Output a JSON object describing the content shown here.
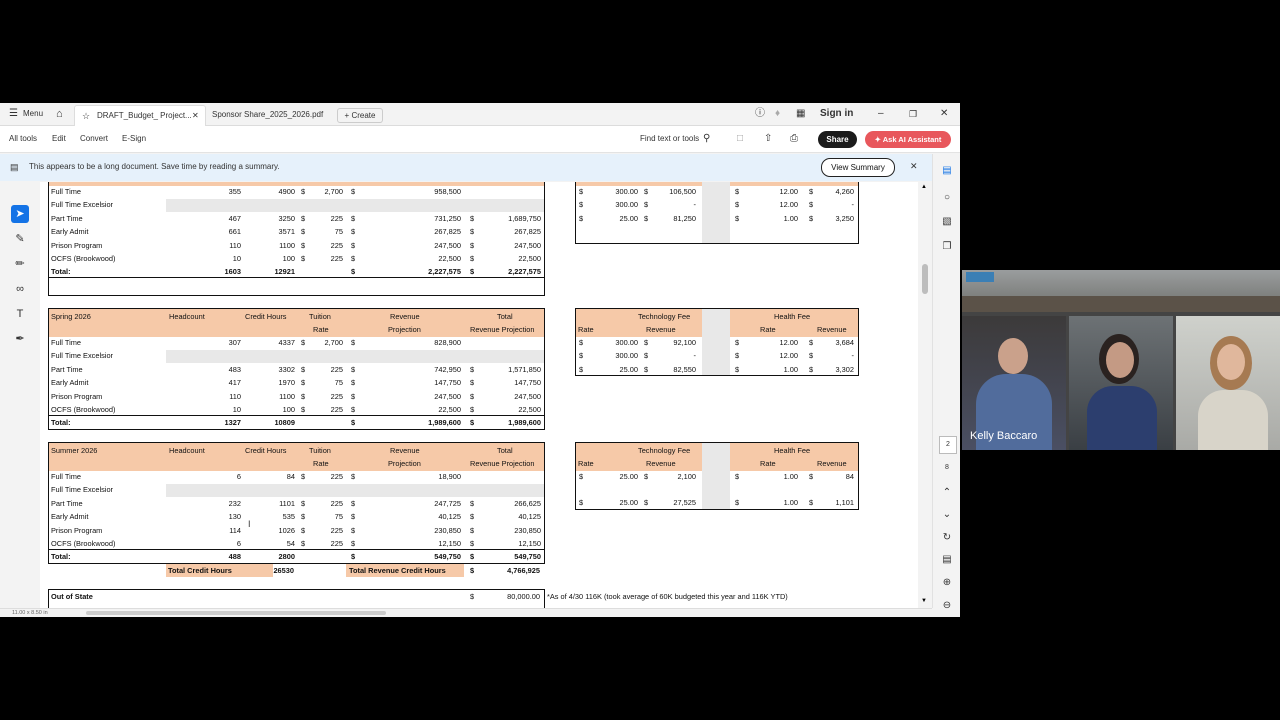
{
  "window": {
    "menu_label": "Menu",
    "tabs": [
      {
        "label": "DRAFT_Budget_ Project..."
      },
      {
        "label": "Sponsor Share_2025_2026.pdf"
      }
    ],
    "create_label": "Create",
    "sign_in": "Sign in"
  },
  "toolbar": {
    "items": [
      "All tools",
      "Edit",
      "Convert",
      "E-Sign"
    ],
    "find_label": "Find text or tools",
    "share_label": "Share",
    "ai_label": "Ask AI Assistant"
  },
  "banner": {
    "message": "This appears to be a long document. Save time by reading a summary.",
    "button": "View Summary"
  },
  "page_size": "11.00 x 8.50 in",
  "page_numbers": [
    "2",
    "8"
  ],
  "fall_table": {
    "rows": [
      {
        "label": "Full Time",
        "headcount": "355",
        "hours": "4900",
        "rate": "2,700",
        "projection": "958,500",
        "total": ""
      },
      {
        "label": "Full Time Excelsior",
        "headcount": "",
        "hours": "",
        "rate": "",
        "projection": "",
        "total": ""
      },
      {
        "label": "Part Time",
        "headcount": "467",
        "hours": "3250",
        "rate": "225",
        "projection": "731,250",
        "total": "1,689,750"
      },
      {
        "label": "Early Admit",
        "headcount": "661",
        "hours": "3571",
        "rate": "75",
        "projection": "267,825",
        "total": "267,825"
      },
      {
        "label": "Prison Program",
        "headcount": "110",
        "hours": "1100",
        "rate": "225",
        "projection": "247,500",
        "total": "247,500"
      },
      {
        "label": "OCFS (Brookwood)",
        "headcount": "10",
        "hours": "100",
        "rate": "225",
        "projection": "22,500",
        "total": "22,500"
      },
      {
        "label": "Total:",
        "headcount": "1603",
        "hours": "12921",
        "rate": "",
        "projection": "2,227,575",
        "total": "2,227,575"
      }
    ]
  },
  "fall_fees": {
    "rows": [
      {
        "tech_rate": "300.00",
        "tech_rev": "106,500",
        "health_rate": "12.00",
        "health_rev": "4,260"
      },
      {
        "tech_rate": "300.00",
        "tech_rev": "-",
        "health_rate": "12.00",
        "health_rev": "-"
      },
      {
        "tech_rate": "25.00",
        "tech_rev": "81,250",
        "health_rate": "1.00",
        "health_rev": "3,250"
      }
    ]
  },
  "spring_table": {
    "term": "Spring 2026",
    "headers": {
      "headcount": "Headcount",
      "hours": "Credit Hours",
      "tuition": "Tuition",
      "rate": "Rate",
      "revenue": "Revenue",
      "projection": "Projection",
      "total": "Total",
      "total_projection": "Revenue Projection"
    },
    "rows": [
      {
        "label": "Full Time",
        "headcount": "307",
        "hours": "4337",
        "rate": "2,700",
        "projection": "828,900",
        "total": ""
      },
      {
        "label": "Full Time Excelsior",
        "headcount": "",
        "hours": "",
        "rate": "",
        "projection": "",
        "total": ""
      },
      {
        "label": "Part Time",
        "headcount": "483",
        "hours": "3302",
        "rate": "225",
        "projection": "742,950",
        "total": "1,571,850"
      },
      {
        "label": "Early Admit",
        "headcount": "417",
        "hours": "1970",
        "rate": "75",
        "projection": "147,750",
        "total": "147,750"
      },
      {
        "label": "Prison Program",
        "headcount": "110",
        "hours": "1100",
        "rate": "225",
        "projection": "247,500",
        "total": "247,500"
      },
      {
        "label": "OCFS (Brookwood)",
        "headcount": "10",
        "hours": "100",
        "rate": "225",
        "projection": "22,500",
        "total": "22,500"
      },
      {
        "label": "Total:",
        "headcount": "1327",
        "hours": "10809",
        "rate": "",
        "projection": "1,989,600",
        "total": "1,989,600"
      }
    ]
  },
  "spring_fees": {
    "tech_title": "Technology Fee",
    "health_title": "Health Fee",
    "rate_label": "Rate",
    "revenue_label": "Revenue",
    "rows": [
      {
        "tech_rate": "300.00",
        "tech_rev": "92,100",
        "health_rate": "12.00",
        "health_rev": "3,684"
      },
      {
        "tech_rate": "300.00",
        "tech_rev": "-",
        "health_rate": "12.00",
        "health_rev": "-"
      },
      {
        "tech_rate": "25.00",
        "tech_rev": "82,550",
        "health_rate": "1.00",
        "health_rev": "3,302"
      }
    ]
  },
  "summer_table": {
    "term": "Summer 2026",
    "headers": {
      "headcount": "Headcount",
      "hours": "Credit Hours",
      "tuition": "Tuition",
      "rate": "Rate",
      "revenue": "Revenue",
      "projection": "Projection",
      "total": "Total",
      "total_projection": "Revenue Projection"
    },
    "rows": [
      {
        "label": "Full Time",
        "headcount": "6",
        "hours": "84",
        "rate": "225",
        "projection": "18,900",
        "total": ""
      },
      {
        "label": "Full Time Excelsior",
        "headcount": "",
        "hours": "",
        "rate": "",
        "projection": "",
        "total": ""
      },
      {
        "label": "Part Time",
        "headcount": "232",
        "hours": "1101",
        "rate": "225",
        "projection": "247,725",
        "total": "266,625"
      },
      {
        "label": "Early Admit",
        "headcount": "130",
        "hours": "535",
        "rate": "75",
        "projection": "40,125",
        "total": "40,125"
      },
      {
        "label": "Prison Program",
        "headcount": "114",
        "hours": "1026",
        "rate": "225",
        "projection": "230,850",
        "total": "230,850"
      },
      {
        "label": "OCFS (Brookwood)",
        "headcount": "6",
        "hours": "54",
        "rate": "225",
        "projection": "12,150",
        "total": "12,150"
      },
      {
        "label": "Total:",
        "headcount": "488",
        "hours": "2800",
        "rate": "",
        "projection": "549,750",
        "total": "549,750"
      }
    ],
    "total_credit_hours_label": "Total Credit Hours",
    "total_credit_hours": "26530",
    "total_revenue_label": "Total Revenue Credit Hours",
    "total_revenue": "4,766,925"
  },
  "summer_fees": {
    "tech_title": "Technology Fee",
    "health_title": "Health Fee",
    "rate_label": "Rate",
    "revenue_label": "Revenue",
    "rows": [
      {
        "tech_rate": "25.00",
        "tech_rev": "2,100",
        "health_rate": "1.00",
        "health_rev": "84"
      },
      {
        "tech_rate": "25.00",
        "tech_rev": "27,525",
        "health_rate": "1.00",
        "health_rev": "1,101"
      }
    ]
  },
  "out_of_state": {
    "label": "Out of State",
    "amount": "80,000.00",
    "note": "*As of 4/30 116K (took average of 60K budgeted this year and 116K YTD)"
  },
  "video": {
    "speaker_name": "Kelly Baccaro"
  }
}
